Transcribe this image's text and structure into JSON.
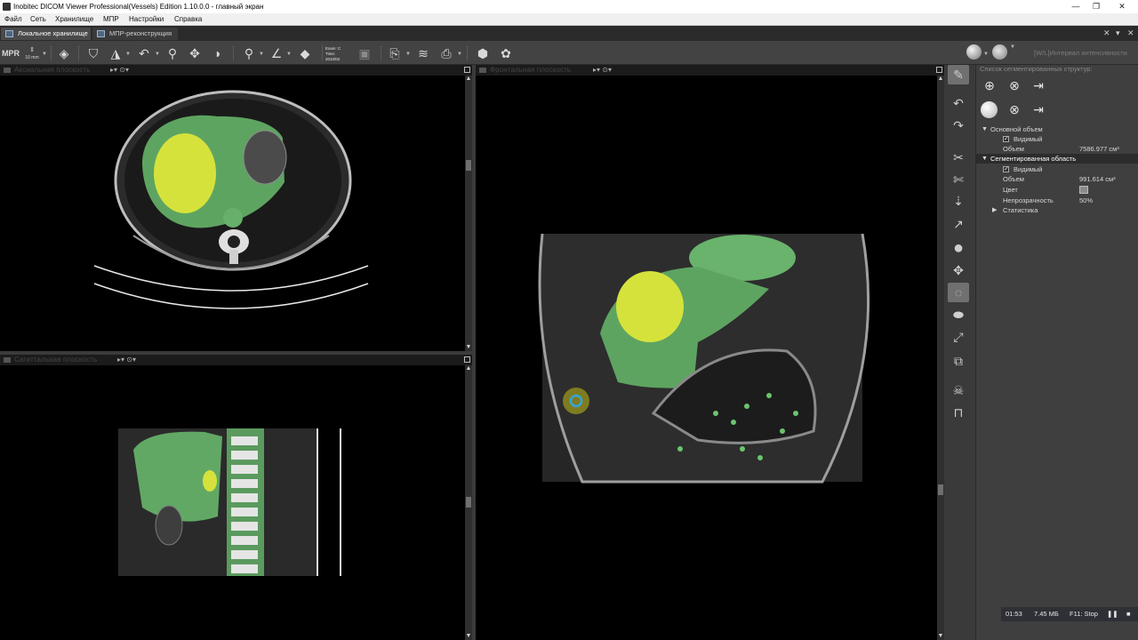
{
  "window": {
    "title": "Inobitec DICOM Viewer Professional(Vessels) Edition 1.10.0.0 - главный экран",
    "minimize": "—",
    "restore": "❐",
    "close": "✕"
  },
  "menu": [
    "Файл",
    "Сеть",
    "Хранилище",
    "МПР",
    "Настройки",
    "Справка"
  ],
  "tabs": [
    {
      "label": "Локальное хранилище",
      "active": true
    },
    {
      "label": "МПР-реконструкция",
      "active": false
    }
  ],
  "tab_controls": {
    "close": "✕",
    "list": "▾",
    "close_all": "✕"
  },
  "toolbar": {
    "mpr_label": "MPR",
    "slice_label": "10 mm",
    "exam_text": "Exam: C\nTime:\n2010/02",
    "wl_label": "[W/L]Интервал интенсивности"
  },
  "viewports": {
    "axial": {
      "title": "Аксиальная плоскость"
    },
    "sagittal": {
      "title": "Сагиттальная плоскость"
    },
    "coronal": {
      "title": "Фронтальная плоскость"
    }
  },
  "panel": {
    "header": "Список сегментированных структур:",
    "main_volume": {
      "label": "Основной объем",
      "visible_label": "Видимый",
      "volume_label": "Объем",
      "volume_value": "7586.977 см³"
    },
    "segment": {
      "label": "Сегментированная область",
      "visible_label": "Видимый",
      "volume_label": "Объем",
      "volume_value": "991.614 см³",
      "color_label": "Цвет",
      "opacity_label": "Непрозрачность",
      "opacity_value": "50%",
      "stats_label": "Статистика"
    }
  },
  "status": {
    "time": "01:53",
    "size": "7.45 МБ",
    "hotkey": "F11: Stop"
  },
  "colors": {
    "segment_fill": "#7fe08a",
    "roi": "#e3ef3c"
  }
}
